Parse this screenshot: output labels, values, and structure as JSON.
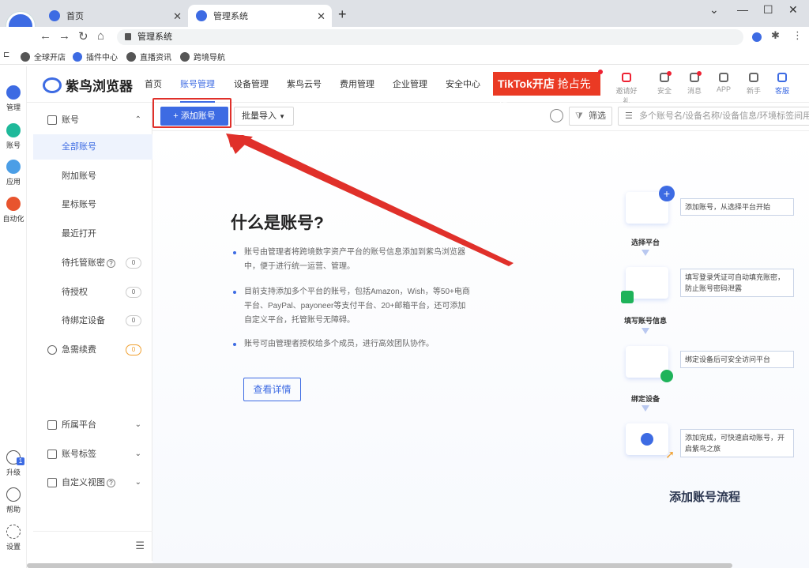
{
  "browser": {
    "tabs": [
      {
        "label": "首页"
      },
      {
        "label": "管理系统"
      }
    ],
    "address": "管理系统",
    "bookmarks": [
      "全球开店",
      "插件中心",
      "直播资讯",
      "跨境导航"
    ]
  },
  "rail": {
    "items": [
      "管理",
      "账号",
      "应用",
      "自动化"
    ],
    "bottom": [
      "升级",
      "帮助",
      "设置"
    ],
    "upgrade_badge": "1"
  },
  "header": {
    "brand": "紫鸟浏览器",
    "nav": [
      "首页",
      "账号管理",
      "设备管理",
      "紫鸟云号",
      "费用管理",
      "企业管理",
      "安全中心"
    ],
    "banner": {
      "brand": "TikTok开店",
      "slogan": "抢占先机"
    },
    "icons": [
      "邀请好礼",
      "安全",
      "消息",
      "APP",
      "新手",
      "客服"
    ]
  },
  "sidebar": {
    "section": "账号",
    "items": [
      {
        "label": "全部账号"
      },
      {
        "label": "附加账号"
      },
      {
        "label": "星标账号"
      },
      {
        "label": "最近打开"
      },
      {
        "label": "待托管账密",
        "count": "0"
      },
      {
        "label": "待授权",
        "count": "0"
      },
      {
        "label": "待绑定设备",
        "count": "0"
      }
    ],
    "renew": {
      "label": "急需续费",
      "count": "0"
    },
    "groups": [
      "所属平台",
      "账号标签",
      "自定义视图"
    ]
  },
  "toolbar": {
    "add_label": "+ 添加账号",
    "import_label": "批量导入",
    "filter_label": "筛选",
    "search_placeholder": "多个账号名/设备名称/设备信息/环境标签间用"
  },
  "main": {
    "title": "什么是账号?",
    "bullets": [
      "账号由管理者将跨境数字资产平台的账号信息添加到紫鸟浏览器中，便于进行统一运营、管理。",
      "目前支持添加多个平台的账号，包括Amazon，Wish，等50+电商平台、PayPal、payoneer等支付平台、20+邮箱平台，还可添加自定义平台，托管账号无障碍。",
      "账号可由管理者授权给多个成员，进行高效团队协作。"
    ],
    "detail_label": "查看详情"
  },
  "flow": {
    "steps": [
      {
        "label": "选择平台",
        "desc": "添加账号，从选择平台开始"
      },
      {
        "label": "填写账号信息",
        "desc": "填写登录凭证可自动填充账密，防止账号密码泄露"
      },
      {
        "label": "绑定设备",
        "desc": "绑定设备后可安全访问平台"
      },
      {
        "label": "",
        "desc": "添加完成，可快速启动账号，开启紫鸟之旅"
      }
    ],
    "title": "添加账号流程"
  },
  "colors": {
    "accent": "#3d6be3",
    "highlight": "#e0302a",
    "banner": "#ea3a24"
  }
}
